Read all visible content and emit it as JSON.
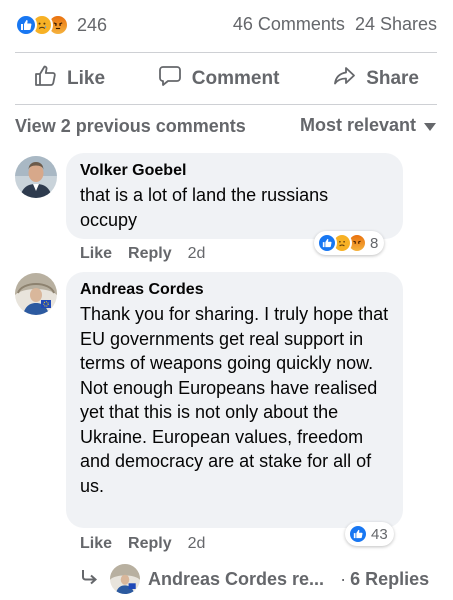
{
  "summary": {
    "reaction_count": "246",
    "comments": "46 Comments",
    "shares": "24 Shares"
  },
  "actions": {
    "like": "Like",
    "comment": "Comment",
    "share": "Share"
  },
  "comments_header": {
    "previous": "View 2 previous comments",
    "sort": "Most relevant"
  },
  "comments": [
    {
      "author": "Volker Goebel",
      "text": "that is a lot of land the russians occupy",
      "like": "Like",
      "reply": "Reply",
      "time": "2d",
      "reaction_count": "8"
    },
    {
      "author": "Andreas Cordes",
      "text": "Thank you for sharing. I truly hope that EU governments get real support in terms of weapons going quickly now. Not enough Europeans have realised yet that this is not only about the Ukraine. European values, freedom and democracy are at stake for all of us.",
      "like": "Like",
      "reply": "Reply",
      "time": "2d",
      "reaction_count": "43"
    }
  ],
  "replies": {
    "author_preview": "Andreas Cordes re...",
    "count": "6 Replies"
  },
  "colors": {
    "like_blue": "#1877f2",
    "muted": "#65676b",
    "bubble": "#f0f2f5"
  }
}
